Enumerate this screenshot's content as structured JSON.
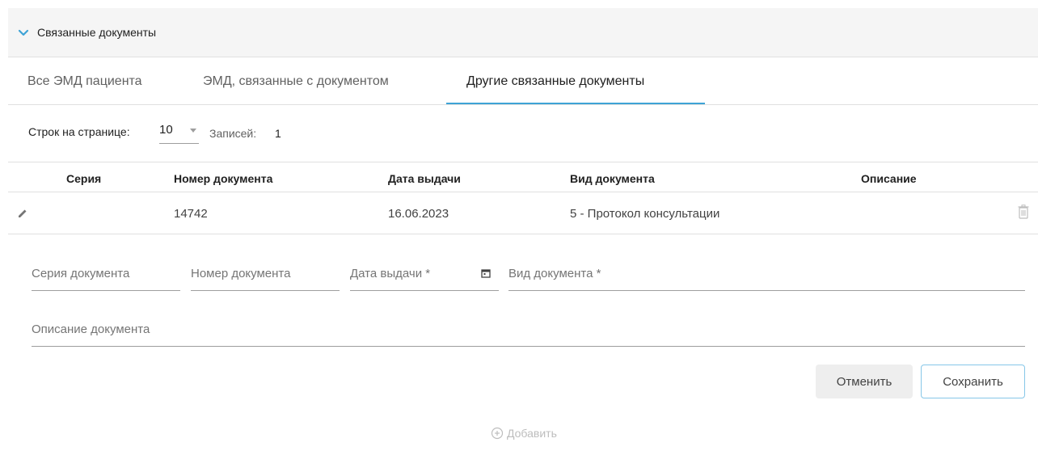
{
  "section": {
    "title": "Связанные документы"
  },
  "tabs": [
    {
      "label": "Все ЭМД пациента"
    },
    {
      "label": "ЭМД, связанные с документом"
    },
    {
      "label": "Другие связанные документы"
    }
  ],
  "active_tab_index": 2,
  "paging": {
    "rows_per_page_label": "Строк на странице:",
    "rows_per_page_value": "10",
    "records_label": "Записей:",
    "records_count": "1"
  },
  "table": {
    "headers": [
      "Серия",
      "Номер документа",
      "Дата выдачи",
      "Вид документа",
      "Описание"
    ],
    "rows": [
      {
        "series": "",
        "number": "14742",
        "issue_date": "16.06.2023",
        "doc_type": "5 - Протокол консультации",
        "description": ""
      }
    ]
  },
  "form": {
    "series_placeholder": "Серия документа",
    "number_placeholder": "Номер документа",
    "issue_date_placeholder": "Дата выдачи *",
    "doc_type_placeholder": "Вид документа *",
    "description_placeholder": "Описание документа"
  },
  "buttons": {
    "cancel": "Отменить",
    "save": "Сохранить"
  },
  "add_link": "Добавить",
  "colors": {
    "accent": "#3ea3d6",
    "header_bg": "#f5f5f5",
    "disabled": "#bdbdbd"
  }
}
